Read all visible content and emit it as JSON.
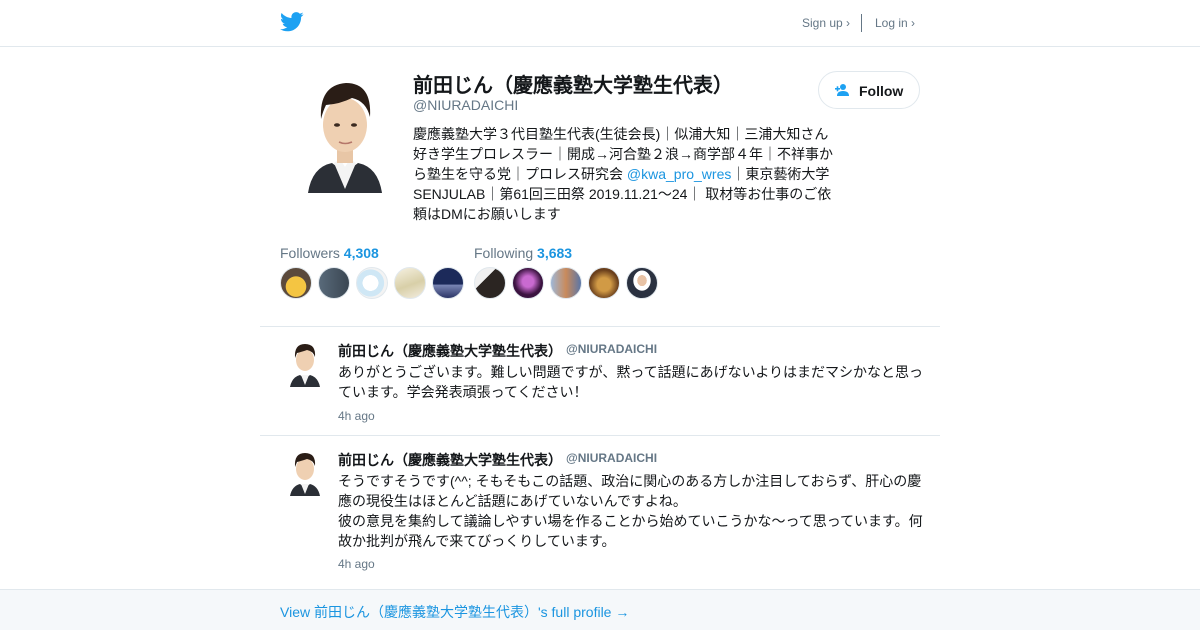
{
  "header": {
    "logo_icon": "twitter-bird-icon",
    "signup_label": "Sign up ›",
    "login_label": "Log in ›"
  },
  "profile": {
    "name": "前田じん（慶應義塾大学塾生代表）",
    "handle": "@NIURADAICHI",
    "bio_part1": "慶應義塾大学３代目塾生代表(生徒会長)｜似浦大知｜三浦大知さん好き学生プロレスラー｜開成→河合塾２浪→商学部４年｜不祥事から塾生を守る党｜プロレス研究会 ",
    "bio_mention": "@kwa_pro_wres",
    "bio_part2": "｜東京藝術大学 SENJULAB｜第61回三田祭 2019.11.21～24｜ 取材等お仕事のご依頼はDMにお願いします",
    "follow_label": "Follow",
    "followers_label": "Followers",
    "followers_count": "4,308",
    "following_label": "Following",
    "following_count": "3,683"
  },
  "tweets": [
    {
      "name": "前田じん（慶應義塾大学塾生代表）",
      "handle": "@NIURADAICHI",
      "text": "ありがとうございます。難しい問題ですが、黙って話題にあげないよりはまだマシかなと思っています。学会発表頑張ってください！",
      "time": "4h ago"
    },
    {
      "name": "前田じん（慶應義塾大学塾生代表）",
      "handle": "@NIURADAICHI",
      "text": "そうですそうです(^^; そもそもこの話題、政治に関心のある方しか注目しておらず、肝心の慶應の現役生はほとんど話題にあげていないんですよね。\n彼の意見を集約して議論しやすい場を作ることから始めていこうかな～って思っています。何故か批判が飛んで来てびっくりしています。",
      "time": "4h ago"
    }
  ],
  "footer": {
    "link_label": "View 前田じん（慶應義塾大学塾生代表）'s full profile →"
  },
  "colors": {
    "accent": "#1b95e0",
    "twitter_blue": "#1da1f2",
    "muted": "#657786",
    "border": "#e1e8ed"
  }
}
